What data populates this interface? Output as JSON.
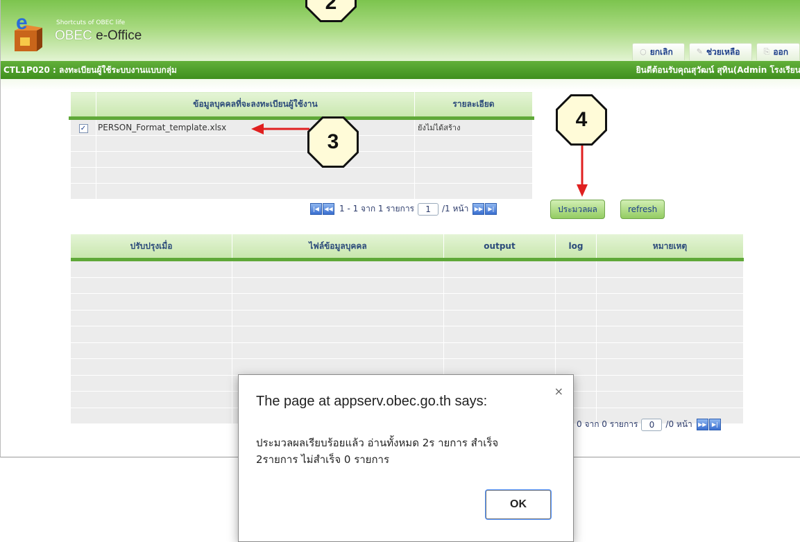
{
  "app": {
    "tagline": "Shortcuts of OBEC life",
    "title_brand": "OBEC",
    "title_rest": " e-Office"
  },
  "topnav": [
    {
      "icon": "circle-icon",
      "label": "ยกเลิก"
    },
    {
      "icon": "pencil-icon",
      "label": "ช่วยเหลือ"
    },
    {
      "icon": "exit-icon",
      "label": "ออก"
    }
  ],
  "subbar": {
    "page_code": "CTL1P020 : ลงทะเบียนผู้ใช้ระบบงานแบบกลุ่ม",
    "welcome": "ยินดีต้อนรับคุณสุวัฒน์ สุทิน(Admin โรงเรียน"
  },
  "upload_table": {
    "headers": [
      "",
      "ข้อมูลบุคคลที่จะลงทะเบียนผู้ใช้งาน",
      "รายละเอียด"
    ],
    "rows": [
      {
        "checked": true,
        "file": "PERSON_Format_template.xlsx",
        "detail": "ยังไม่ได้สร้าง"
      }
    ]
  },
  "upload_pager": {
    "summary": "1 - 1 จาก 1 รายการ",
    "page_value": "1",
    "total": "/1 หน้า"
  },
  "actions": {
    "process_label": "ประมวลผล",
    "refresh_label": "refresh"
  },
  "results_table": {
    "headers": [
      "ปรับปรุงเมื่อ",
      "ไฟล์ข้อมูลบุคคล",
      "output",
      "log",
      "หมายเหตุ"
    ]
  },
  "results_pager": {
    "summary": "0 จาก 0 รายการ",
    "page_value": "0",
    "total": "/0 หน้า"
  },
  "callouts": {
    "c2": "2",
    "c3": "3",
    "c4": "4"
  },
  "dialog": {
    "title": "The page at appserv.obec.go.th says:",
    "message_line1": "ประมวลผลเรียบร้อยแล้ว อ่านทั้งหมด 2ร ายการ  สำเร็จ",
    "message_line2": "2รายการ  ไม่สำเร็จ 0 รายการ",
    "ok_label": "OK",
    "close_glyph": "×"
  },
  "colors": {
    "brand_green": "#4f9f2a",
    "arrow_red": "#e02020",
    "link_blue": "#1c3e8a"
  }
}
